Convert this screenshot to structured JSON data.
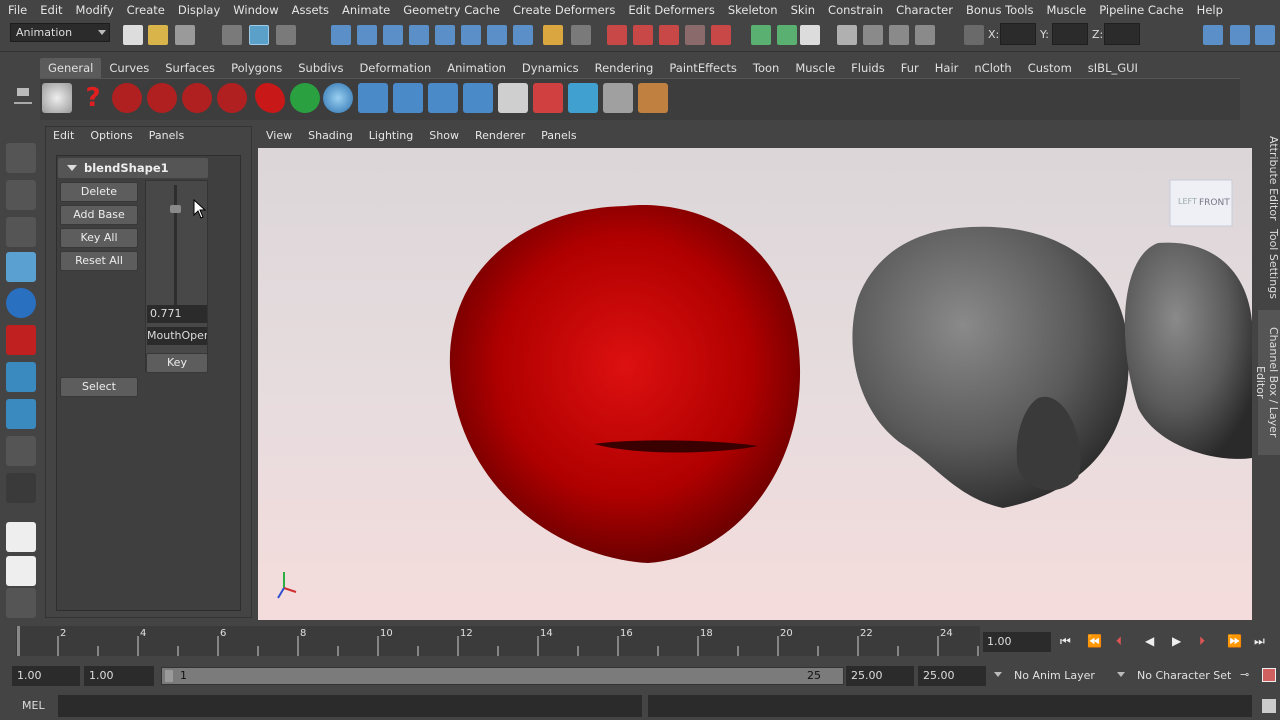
{
  "menubar": [
    "File",
    "Edit",
    "Modify",
    "Create",
    "Display",
    "Window",
    "Assets",
    "Animate",
    "Geometry Cache",
    "Create Deformers",
    "Edit Deformers",
    "Skeleton",
    "Skin",
    "Constrain",
    "Character",
    "Bonus Tools",
    "Muscle",
    "Pipeline Cache",
    "Help"
  ],
  "statusline": {
    "mode": "Animation",
    "x_label": "X:",
    "y_label": "Y:",
    "z_label": "Z:"
  },
  "shelf_tabs": [
    "General",
    "Curves",
    "Surfaces",
    "Polygons",
    "Subdivs",
    "Deformation",
    "Animation",
    "Dynamics",
    "Rendering",
    "PaintEffects",
    "Toon",
    "Muscle",
    "Fluids",
    "Fur",
    "Hair",
    "nCloth",
    "Custom",
    "sIBL_GUI"
  ],
  "shelf_active": "General",
  "blendshape_panel": {
    "menu": [
      "Edit",
      "Options",
      "Panels"
    ],
    "node_name": "blendShape1",
    "buttons": {
      "delete": "Delete",
      "add_base": "Add Base",
      "key_all": "Key All",
      "reset_all": "Reset All",
      "select": "Select",
      "key": "Key"
    },
    "target_weight": "0.771",
    "target_name": "MouthOpen"
  },
  "viewport": {
    "menu": [
      "View",
      "Shading",
      "Lighting",
      "Show",
      "Renderer",
      "Panels"
    ],
    "viewcube_left": "LEFT",
    "viewcube_front": "FRONT",
    "head_color": "#c00000"
  },
  "right_tabs": [
    "Attribute Editor",
    "Tool Settings",
    "Channel Box / Layer Editor"
  ],
  "timeline": {
    "ticks": [
      "2",
      "4",
      "6",
      "8",
      "10",
      "12",
      "14",
      "16",
      "18",
      "20",
      "22",
      "24"
    ],
    "current_frame": "1.00"
  },
  "range": {
    "start": "1.00",
    "playback_start": "1.00",
    "range_left": "1",
    "range_right": "25",
    "playback_end": "25.00",
    "end": "25.00",
    "anim_layer": "No Anim Layer",
    "character_set": "No Character Set"
  },
  "command_line": {
    "label": "MEL"
  }
}
